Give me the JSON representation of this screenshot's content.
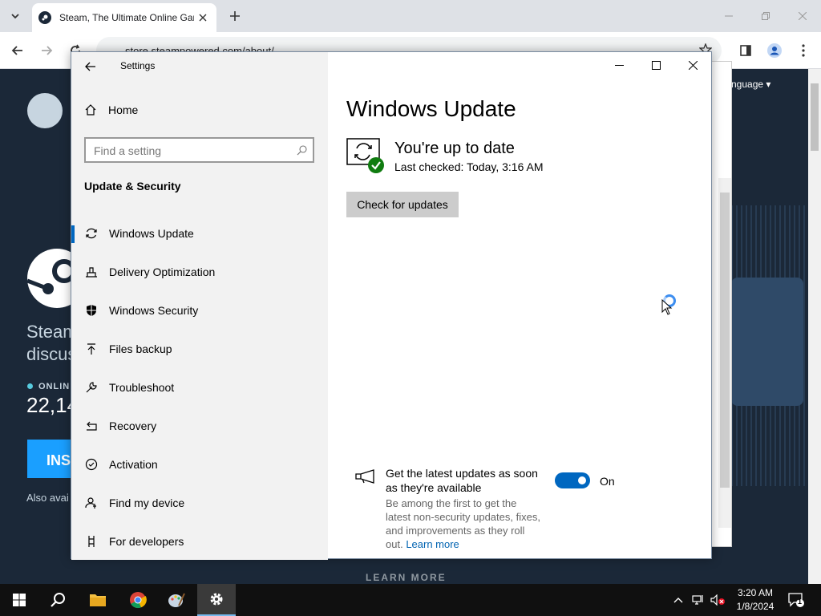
{
  "browser": {
    "tab_title": "Steam, The Ultimate Online Gar",
    "url": "store.steampowered.com/about/"
  },
  "steam": {
    "headline_line1": "Steam",
    "headline_line2": "discus",
    "online_label": "ONLINE",
    "online_count": "22,14",
    "install_label": "INS",
    "also_available": "Also avai",
    "learn_more": "LEARN MORE",
    "language": "nguage ▾",
    "help": "?"
  },
  "settings": {
    "window_title": "Settings",
    "home_label": "Home",
    "search_placeholder": "Find a setting",
    "section_title": "Update & Security",
    "nav_items": [
      {
        "label": "Windows Update",
        "icon": "sync-icon"
      },
      {
        "label": "Delivery Optimization",
        "icon": "delivery-optimization-icon"
      },
      {
        "label": "Windows Security",
        "icon": "shield-icon"
      },
      {
        "label": "Files backup",
        "icon": "backup-icon"
      },
      {
        "label": "Troubleshoot",
        "icon": "wrench-icon"
      },
      {
        "label": "Recovery",
        "icon": "recovery-icon"
      },
      {
        "label": "Activation",
        "icon": "check-circle-icon"
      },
      {
        "label": "Find my device",
        "icon": "person-location-icon"
      },
      {
        "label": "For developers",
        "icon": "developer-icon"
      }
    ],
    "page_title": "Windows Update",
    "status_heading": "You're up to date",
    "last_checked": "Last checked: Today, 3:16 AM",
    "check_button": "Check for updates",
    "promo_heading": "Get the latest updates as soon as they're available",
    "promo_desc": "Be among the first to get the latest non-security updates, fixes, and improvements as they roll out.",
    "promo_link": "Learn more",
    "toggle_state": "On"
  },
  "taskbar": {
    "time": "3:20 AM",
    "date": "1/8/2024",
    "notification_count": "1"
  },
  "colors": {
    "accent": "#0067c0",
    "steam_bg": "#1b2838",
    "steam_blue": "#1a9fff"
  }
}
